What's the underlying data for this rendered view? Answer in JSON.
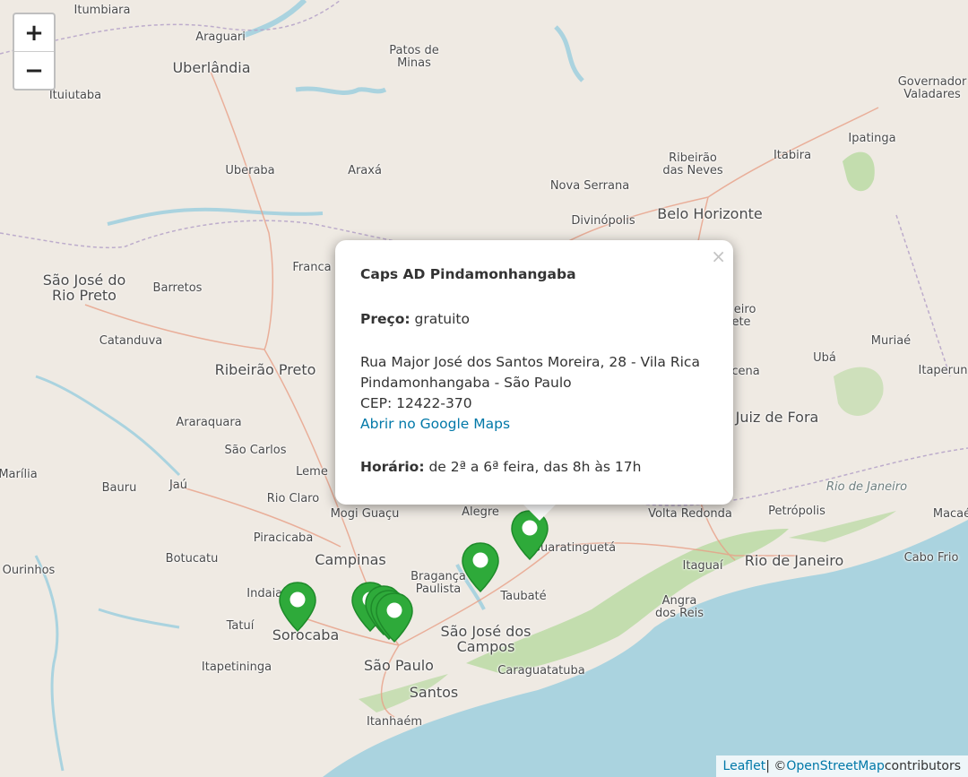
{
  "zoom": {
    "in_label": "+",
    "out_label": "−"
  },
  "cities": [
    {
      "name": "Itumbiara",
      "size": "small"
    },
    {
      "name": "Araguari",
      "size": "small"
    },
    {
      "name": "Uberlândia",
      "size": "big"
    },
    {
      "name": "Ituiutaba",
      "size": "small"
    },
    {
      "name": "Patos de\nMinas",
      "size": "small"
    },
    {
      "name": "Governador\nValadares",
      "size": "small"
    },
    {
      "name": "Ipatinga",
      "size": "small"
    },
    {
      "name": "Itabira",
      "size": "small"
    },
    {
      "name": "Ribeirão\ndas Neves",
      "size": "small"
    },
    {
      "name": "Uberaba",
      "size": "small"
    },
    {
      "name": "Araxá",
      "size": "small"
    },
    {
      "name": "Nova Serrana",
      "size": "small"
    },
    {
      "name": "Belo Horizonte",
      "size": "big"
    },
    {
      "name": "Divinópolis",
      "size": "small"
    },
    {
      "name": "São José do\nRio Preto",
      "size": "big"
    },
    {
      "name": "Barretos",
      "size": "small"
    },
    {
      "name": "Franca",
      "size": "small"
    },
    {
      "name": "Catanduva",
      "size": "small"
    },
    {
      "name": "Ribeirão Preto",
      "size": "big"
    },
    {
      "name": "Araraquara",
      "size": "small"
    },
    {
      "name": "São Carlos",
      "size": "small"
    },
    {
      "name": "Marília",
      "size": "small"
    },
    {
      "name": "Bauru",
      "size": "small"
    },
    {
      "name": "Jaú",
      "size": "small"
    },
    {
      "name": "Leme",
      "size": "small"
    },
    {
      "name": "Rio Claro",
      "size": "small"
    },
    {
      "name": "Mogi Guaçu",
      "size": "small"
    },
    {
      "name": "Alegre",
      "size": "small"
    },
    {
      "name": "Ourinhos",
      "size": "small"
    },
    {
      "name": "Botucatu",
      "size": "small"
    },
    {
      "name": "Piracicaba",
      "size": "small"
    },
    {
      "name": "Campinas",
      "size": "big"
    },
    {
      "name": "Bragança\nPaulista",
      "size": "small"
    },
    {
      "name": "Guaratinguetá",
      "size": "small"
    },
    {
      "name": "Taubaté",
      "size": "small"
    },
    {
      "name": "São José dos\nCampos",
      "size": "big"
    },
    {
      "name": "Tatuí",
      "size": "small"
    },
    {
      "name": "Sorocaba",
      "size": "big"
    },
    {
      "name": "Indaiatuba",
      "size": "small"
    },
    {
      "name": "Itapetininga",
      "size": "small"
    },
    {
      "name": "São Paulo",
      "size": "big"
    },
    {
      "name": "Santos",
      "size": "big"
    },
    {
      "name": "Caraguatatuba",
      "size": "small"
    },
    {
      "name": "Itanhaém",
      "size": "small"
    },
    {
      "name": "Angra\ndos Reis",
      "size": "small"
    },
    {
      "name": "Itaguaí",
      "size": "small"
    },
    {
      "name": "Rio de Janeiro",
      "size": "big"
    },
    {
      "name": "Cabo Frio",
      "size": "small"
    },
    {
      "name": "Petrópolis",
      "size": "small"
    },
    {
      "name": "Volta Redonda",
      "size": "small"
    },
    {
      "name": "Juiz de Fora",
      "size": "big"
    },
    {
      "name": "Ubá",
      "size": "small"
    },
    {
      "name": "Muriaé",
      "size": "small"
    },
    {
      "name": "Itaperun",
      "size": "small"
    },
    {
      "name": "heiro\nete",
      "size": "small"
    },
    {
      "name": "cena",
      "size": "small"
    },
    {
      "name": "Macaé",
      "size": "small"
    },
    {
      "name": "Rio de Janeiro",
      "size": "state"
    }
  ],
  "popup": {
    "title": "Caps AD Pindamonhangaba",
    "price_label": "Preço:",
    "price_value": "gratuito",
    "address_line1": "Rua Major José dos Santos Moreira, 28 - Vila Rica",
    "address_line2": "Pindamonhangaba - São Paulo",
    "cep": "CEP: 12422-370",
    "maps_link": "Abrir no Google Maps",
    "hours_label": "Horário:",
    "hours_value": "de 2ª a 6ª feira, das 8h às 17h",
    "close": "×"
  },
  "markers": [
    {
      "name": "Sorocaba"
    },
    {
      "name": "São Paulo 1"
    },
    {
      "name": "São Paulo 2"
    },
    {
      "name": "São Paulo 3"
    },
    {
      "name": "São Paulo 4"
    },
    {
      "name": "São José dos Campos"
    },
    {
      "name": "Pindamonhangaba"
    }
  ],
  "colors": {
    "marker": "#2eaa3a",
    "ocean": "#aad3df",
    "land": "#efeae3",
    "forest": "#b8d9a0"
  },
  "attribution": {
    "leaflet": "Leaflet",
    "sep": " | © ",
    "osm": "OpenStreetMap",
    "rest": " contributors"
  }
}
